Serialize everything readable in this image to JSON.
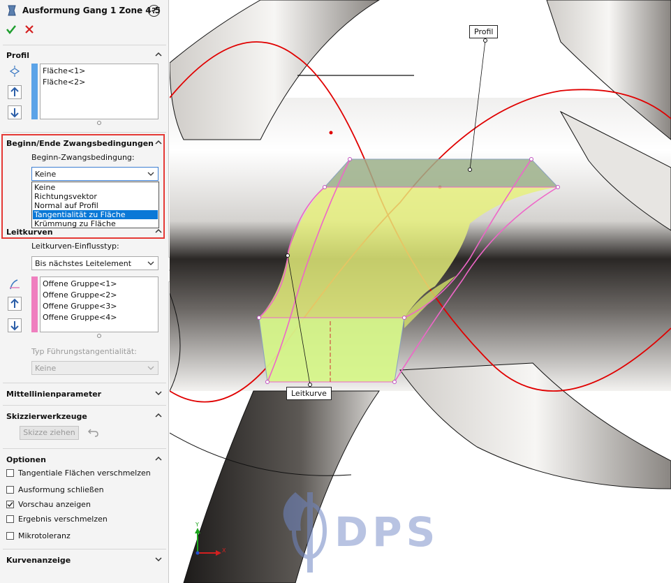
{
  "feature": {
    "title": "Ausformung Gang 1 Zone 4-5",
    "help_icon": "?"
  },
  "actions": {
    "ok_icon": "checkmark-icon",
    "cancel_icon": "x-icon"
  },
  "profil": {
    "header": "Profil",
    "items": [
      "Fläche<1>",
      "Fläche<2>"
    ],
    "bar_color": "#5ba3e8"
  },
  "constraints": {
    "header": "Beginn/Ende Zwangsbedingungen",
    "label": "Beginn-Zwangsbedingung:",
    "selected": "Keine",
    "options": [
      "Keine",
      "Richtungsvektor",
      "Normal auf Profil",
      "Tangentialität zu Fläche",
      "Krümmung zu Fläche"
    ],
    "highlighted": "Tangentialität zu Fläche"
  },
  "leitkurven": {
    "header": "Leitkurven",
    "influence_label": "Leitkurven-Einflusstyp:",
    "influence_value": "Bis nächstes Leitelement",
    "items": [
      "Offene Gruppe<1>",
      "Offene Gruppe<2>",
      "Offene Gruppe<3>",
      "Offene Gruppe<4>"
    ],
    "bar_color": "#ef7fbf",
    "tangency_label": "Typ Führungstangentialität:",
    "tangency_value": "Keine"
  },
  "mittellinie": {
    "header": "Mittellinienparameter"
  },
  "skizzier": {
    "header": "Skizzierwerkzeuge",
    "button": "Skizze ziehen"
  },
  "optionen": {
    "header": "Optionen",
    "items": [
      {
        "label": "Tangentiale Flächen verschmelzen",
        "checked": false
      },
      {
        "label": "Ausformung schließen",
        "checked": false
      },
      {
        "label": "Vorschau anzeigen",
        "checked": true
      },
      {
        "label": "Ergebnis verschmelzen",
        "checked": false
      },
      {
        "label": "Mikrotoleranz",
        "checked": false
      }
    ]
  },
  "kurvenanzeige": {
    "header": "Kurvenanzeige"
  },
  "viewport": {
    "callout_profil": "Profil",
    "callout_leitkurve": "Leitkurve",
    "watermark": "DPS",
    "axis_y": "Y",
    "axis_x": "X",
    "highlight_color": "#e53935",
    "curve_color": "#e00000",
    "surface_color": "#e6f07a"
  }
}
